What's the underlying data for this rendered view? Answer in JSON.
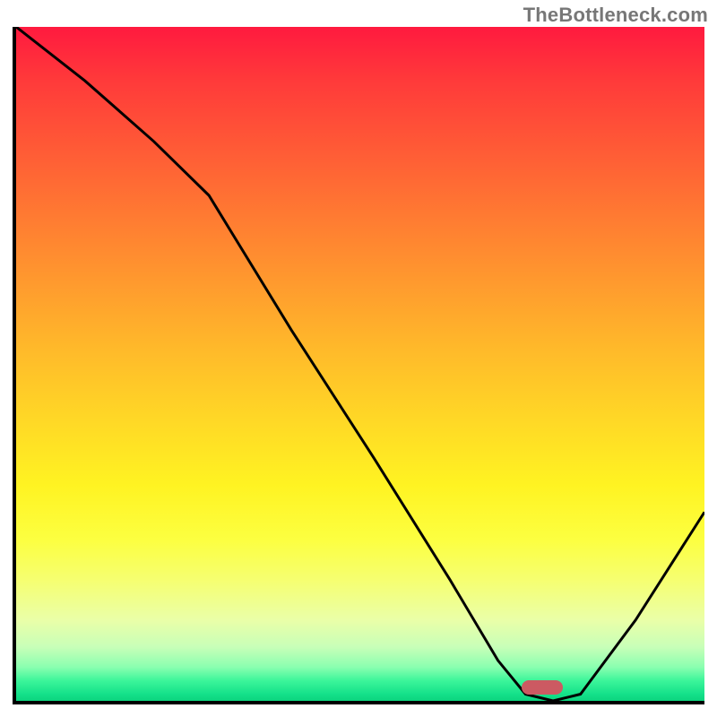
{
  "watermark": "TheBottleneck.com",
  "chart_data": {
    "type": "line",
    "title": "",
    "xlabel": "",
    "ylabel": "",
    "xlim": [
      0,
      100
    ],
    "ylim": [
      0,
      100
    ],
    "grid": false,
    "series": [
      {
        "name": "curve",
        "x": [
          0,
          10,
          20,
          28,
          40,
          52,
          63,
          70,
          74,
          78,
          82,
          90,
          100
        ],
        "y": [
          100,
          92,
          83,
          75,
          55,
          36,
          18,
          6,
          1,
          0,
          1,
          12,
          28
        ]
      }
    ],
    "marker": {
      "x": 76,
      "y": 2,
      "shape": "pill",
      "color": "#cc5a62"
    },
    "background_gradient": {
      "stops": [
        {
          "pct": 0,
          "color": "#ff1a3f"
        },
        {
          "pct": 50,
          "color": "#ffd726"
        },
        {
          "pct": 80,
          "color": "#fcff40"
        },
        {
          "pct": 100,
          "color": "#0cd37e"
        }
      ]
    }
  }
}
